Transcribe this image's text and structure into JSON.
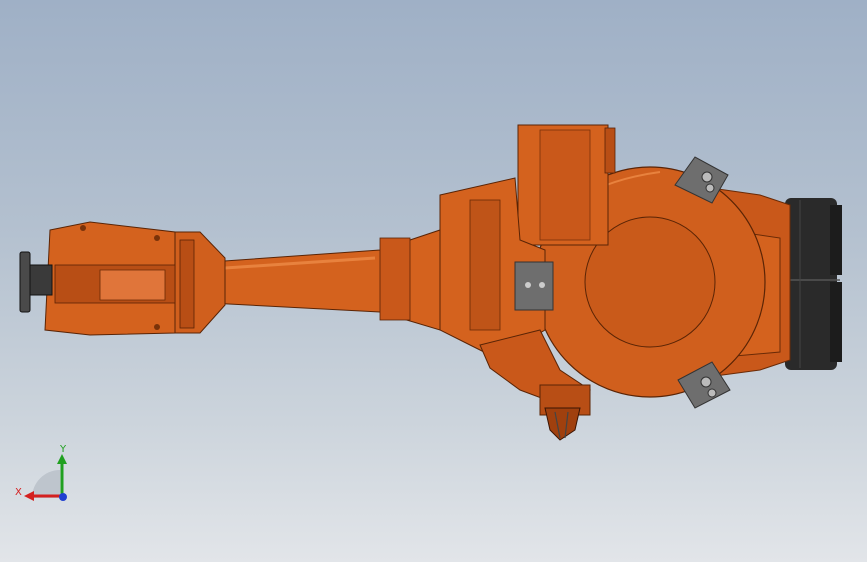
{
  "colors": {
    "background_top": "#9fb0c6",
    "background_bottom": "#e2e5e9",
    "robot_orange": "#d4621e",
    "robot_orange_dark": "#8a3a0e",
    "robot_orange_light": "#e8823e",
    "motor_black": "#2a2a2a",
    "bracket_gray": "#6e6e6e",
    "axis_x": "#d42020",
    "axis_y": "#20a020",
    "axis_z": "#2040d0"
  },
  "triad": {
    "x_label": "X",
    "y_label": "Y"
  }
}
